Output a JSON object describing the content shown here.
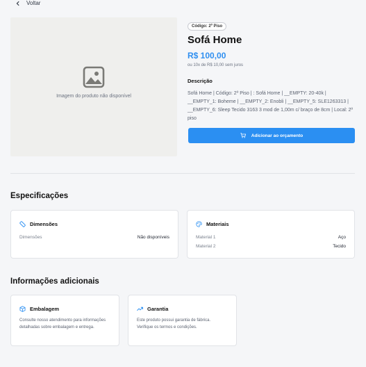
{
  "nav": {
    "back_label": "Voltar"
  },
  "product": {
    "image_placeholder": "Imagem do produto não disponível",
    "code_badge": "Código: 2º Piso",
    "title": "Sofá Home",
    "price": "R$ 100,00",
    "installments": "ou 10x de R$ 10,00 sem juros",
    "description_label": "Descrição",
    "description": "Sofá Home | Código: 2º Piso | : Sofá Home | __EMPTY: 20-40k | __EMPTY_1: Boheme | __EMPTY_2: Enobli | __EMPTY_5: SLE1263313 | __EMPTY_6: Sleep Tecido 3163 3 mod de 1,00m c/ braço de 8cm | Local: 2º piso",
    "add_button_label": "Adicionar ao orçamento"
  },
  "specs": {
    "title": "Especificações",
    "dimensions": {
      "title": "Dimensões",
      "rows": [
        {
          "key": "Dimensões",
          "value": "Não disponíveis"
        }
      ]
    },
    "materials": {
      "title": "Materiais",
      "rows": [
        {
          "key": "Material 1",
          "value": "Aço"
        },
        {
          "key": "Material 2",
          "value": "Tecido"
        }
      ]
    }
  },
  "additional": {
    "title": "Informações adicionais",
    "packaging": {
      "title": "Embalagem",
      "text": "Consulte nosso atendimento para informações detalhadas sobre embalagem e entrega."
    },
    "warranty": {
      "title": "Garantia",
      "text": "Este produto possui garantia de fábrica. Verifique os termos e condições."
    }
  },
  "colors": {
    "accent": "#2b8ff2",
    "page_bg": "#f5f6f8"
  }
}
